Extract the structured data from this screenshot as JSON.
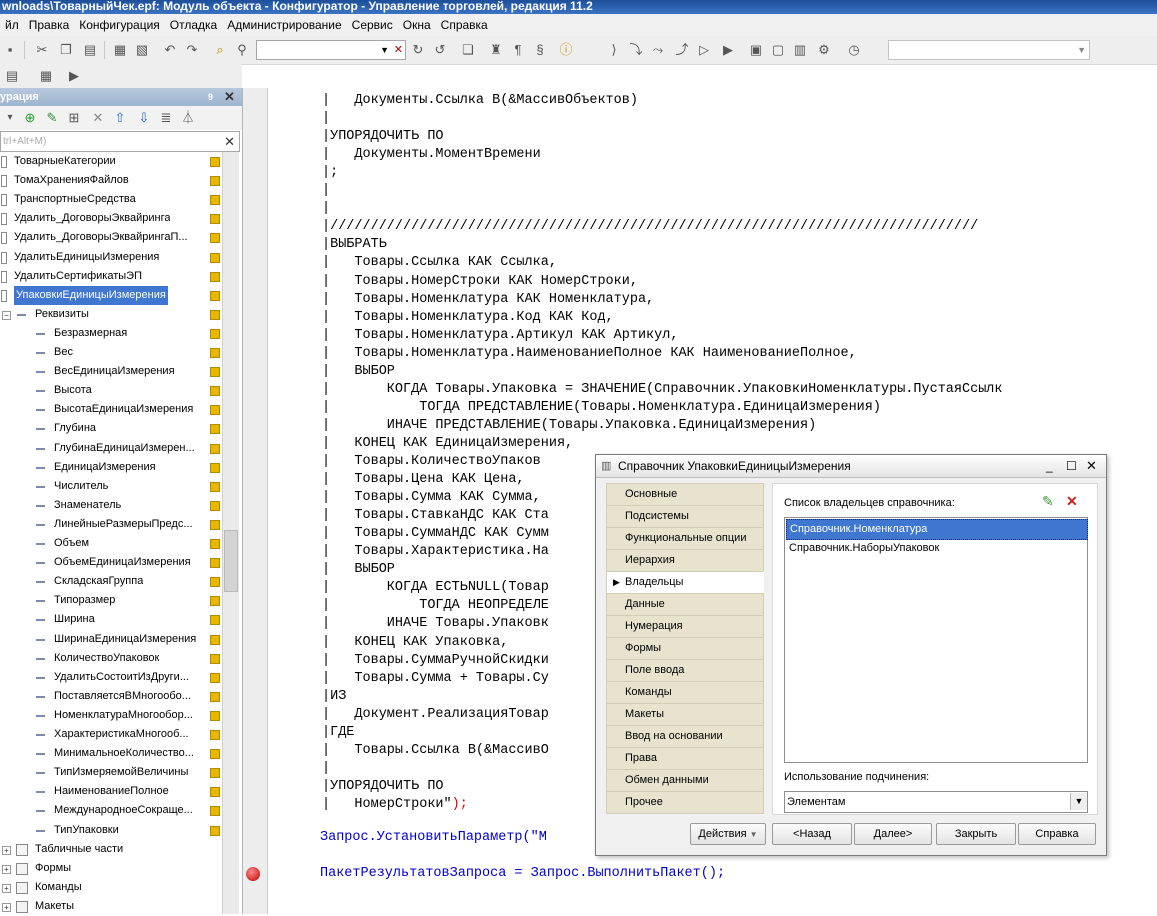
{
  "window": {
    "title": "wnloads\\ТоварныйЧек.epf: Модуль объекта - Конфигуратор - Управление торговлей, редакция 11.2"
  },
  "menu": [
    "йл",
    "Правка",
    "Конфигурация",
    "Отладка",
    "Администрирование",
    "Сервис",
    "Окна",
    "Справка"
  ],
  "left_panel": {
    "title": "урация",
    "pin": "9",
    "search_placeholder": "trl+Alt+M)",
    "items": [
      {
        "label": "ТоварныеКатегории",
        "level": 0
      },
      {
        "label": "ТомаХраненияФайлов",
        "level": 0
      },
      {
        "label": "ТранспортныеСредства",
        "level": 0
      },
      {
        "label": "Удалить_ДоговорыЭквайринга",
        "level": 0
      },
      {
        "label": "Удалить_ДоговорыЭквайрингаП...",
        "level": 0
      },
      {
        "label": "УдалитьЕдиницыИзмерения",
        "level": 0
      },
      {
        "label": "УдалитьСертификатыЭП",
        "level": 0
      },
      {
        "label": "УпаковкиЕдиницыИзмерения",
        "level": 0,
        "selected": true
      },
      {
        "label": "Реквизиты",
        "level": 1,
        "group": true
      },
      {
        "label": "Безразмерная",
        "level": 2
      },
      {
        "label": "Вес",
        "level": 2
      },
      {
        "label": "ВесЕдиницаИзмерения",
        "level": 2
      },
      {
        "label": "Высота",
        "level": 2
      },
      {
        "label": "ВысотаЕдиницаИзмерения",
        "level": 2
      },
      {
        "label": "Глубина",
        "level": 2
      },
      {
        "label": "ГлубинаЕдиницаИзмерен...",
        "level": 2
      },
      {
        "label": "ЕдиницаИзмерения",
        "level": 2
      },
      {
        "label": "Числитель",
        "level": 2
      },
      {
        "label": "Знаменатель",
        "level": 2
      },
      {
        "label": "ЛинейныеРазмерыПредс...",
        "level": 2
      },
      {
        "label": "Объем",
        "level": 2
      },
      {
        "label": "ОбъемЕдиницаИзмерения",
        "level": 2
      },
      {
        "label": "СкладскаяГруппа",
        "level": 2
      },
      {
        "label": "Типоразмер",
        "level": 2
      },
      {
        "label": "Ширина",
        "level": 2
      },
      {
        "label": "ШиринаЕдиницаИзмерения",
        "level": 2
      },
      {
        "label": "КоличествоУпаковок",
        "level": 2
      },
      {
        "label": "УдалитьСостоитИзДруги...",
        "level": 2
      },
      {
        "label": "ПоставляетсяВМногообо...",
        "level": 2
      },
      {
        "label": "НоменклатураМногообор...",
        "level": 2
      },
      {
        "label": "ХарактеристикаМногооб...",
        "level": 2
      },
      {
        "label": "МинимальноеКоличество...",
        "level": 2
      },
      {
        "label": "ТипИзмеряемойВеличины",
        "level": 2
      },
      {
        "label": "НаименованиеПолное",
        "level": 2
      },
      {
        "label": "МеждународноеСокраще...",
        "level": 2
      },
      {
        "label": "ТипУпаковки",
        "level": 2
      },
      {
        "label": "Табличные части",
        "level": 1
      },
      {
        "label": "Формы",
        "level": 1
      },
      {
        "label": "Команды",
        "level": 1
      },
      {
        "label": "Макеты",
        "level": 1
      }
    ]
  },
  "code_lines": [
    "|   Документы.Ссылка В(&МассивОбъектов)",
    "|",
    "|УПОРЯДОЧИТЬ ПО",
    "|   Документы.МоментВремени",
    "|;",
    "|",
    "|",
    "|////////////////////////////////////////////////////////////////////////////////",
    "|ВЫБРАТЬ",
    "|   Товары.Ссылка КАК Ссылка,",
    "|   Товары.НомерСтроки КАК НомерСтроки,",
    "|   Товары.Номенклатура КАК Номенклатура,",
    "|   Товары.Номенклатура.Код КАК Код,",
    "|   Товары.Номенклатура.Артикул КАК Артикул,",
    "|   Товары.Номенклатура.НаименованиеПолное КАК НаименованиеПолное,",
    "|   ВЫБОР",
    "|       КОГДА Товары.Упаковка = ЗНАЧЕНИЕ(Справочник.УпаковкиНоменклатуры.ПустаяСсылк",
    "|           ТОГДА ПРЕДСТАВЛЕНИЕ(Товары.Номенклатура.ЕдиницаИзмерения)",
    "|       ИНАЧЕ ПРЕДСТАВЛЕНИЕ(Товары.Упаковка.ЕдиницаИзмерения)",
    "|   КОНЕЦ КАК ЕдиницаИзмерения,",
    "|   Товары.КоличествоУпаков",
    "|   Товары.Цена КАК Цена,",
    "|   Товары.Сумма КАК Сумма,",
    "|   Товары.СтавкаНДС КАК Ста",
    "|   Товары.СуммаНДС КАК Сумм",
    "|   Товары.Характеристика.На",
    "|   ВЫБОР",
    "|       КОГДА ЕСТЬNULL(Товар",
    "|           ТОГДА НЕОПРЕДЕЛЕ",
    "|       ИНАЧЕ Товары.Упаковк",
    "|   КОНЕЦ КАК Упаковка,",
    "|   Товары.СуммаРучнойСкидки                                                   ,",
    "|   Товары.Сумма + Товары.Су                                                   КАК С",
    "|ИЗ",
    "|   Документ.РеализацияТовар",
    "|ГДЕ",
    "|   Товары.Ссылка В(&МассивО",
    "|",
    "|УПОРЯДОЧИТЬ ПО",
    "|   НомерСтроки\");"
  ],
  "code_after": [
    "Запрос.УстановитьПараметр(\"М",
    "ПакетРезультатовЗапроса = Запрос.ВыполнитьПакет();"
  ],
  "dialog": {
    "title": "Справочник УпаковкиЕдиницыИзмерения",
    "nav": [
      "Основные",
      "Подсистемы",
      "Функциональные опции",
      "Иерархия",
      "Владельцы",
      "Данные",
      "Нумерация",
      "Формы",
      "Поле ввода",
      "Команды",
      "Макеты",
      "Ввод на основании",
      "Права",
      "Обмен данными",
      "Прочее"
    ],
    "active_nav": "Владельцы",
    "owners_label": "Список владельцев справочника:",
    "owners": [
      "Справочник.Номенклатура",
      "Справочник.НаборыУпаковок"
    ],
    "subordination_label": "Использование подчинения:",
    "subordination_value": "Элементам",
    "buttons": {
      "actions": "Действия",
      "back": "<Назад",
      "next": "Далее>",
      "close": "Закрыть",
      "help": "Справка"
    }
  },
  "colors": {
    "selection": "#3f76cf",
    "keyword_red": "#e00000",
    "identifier_blue": "#0000cc"
  }
}
